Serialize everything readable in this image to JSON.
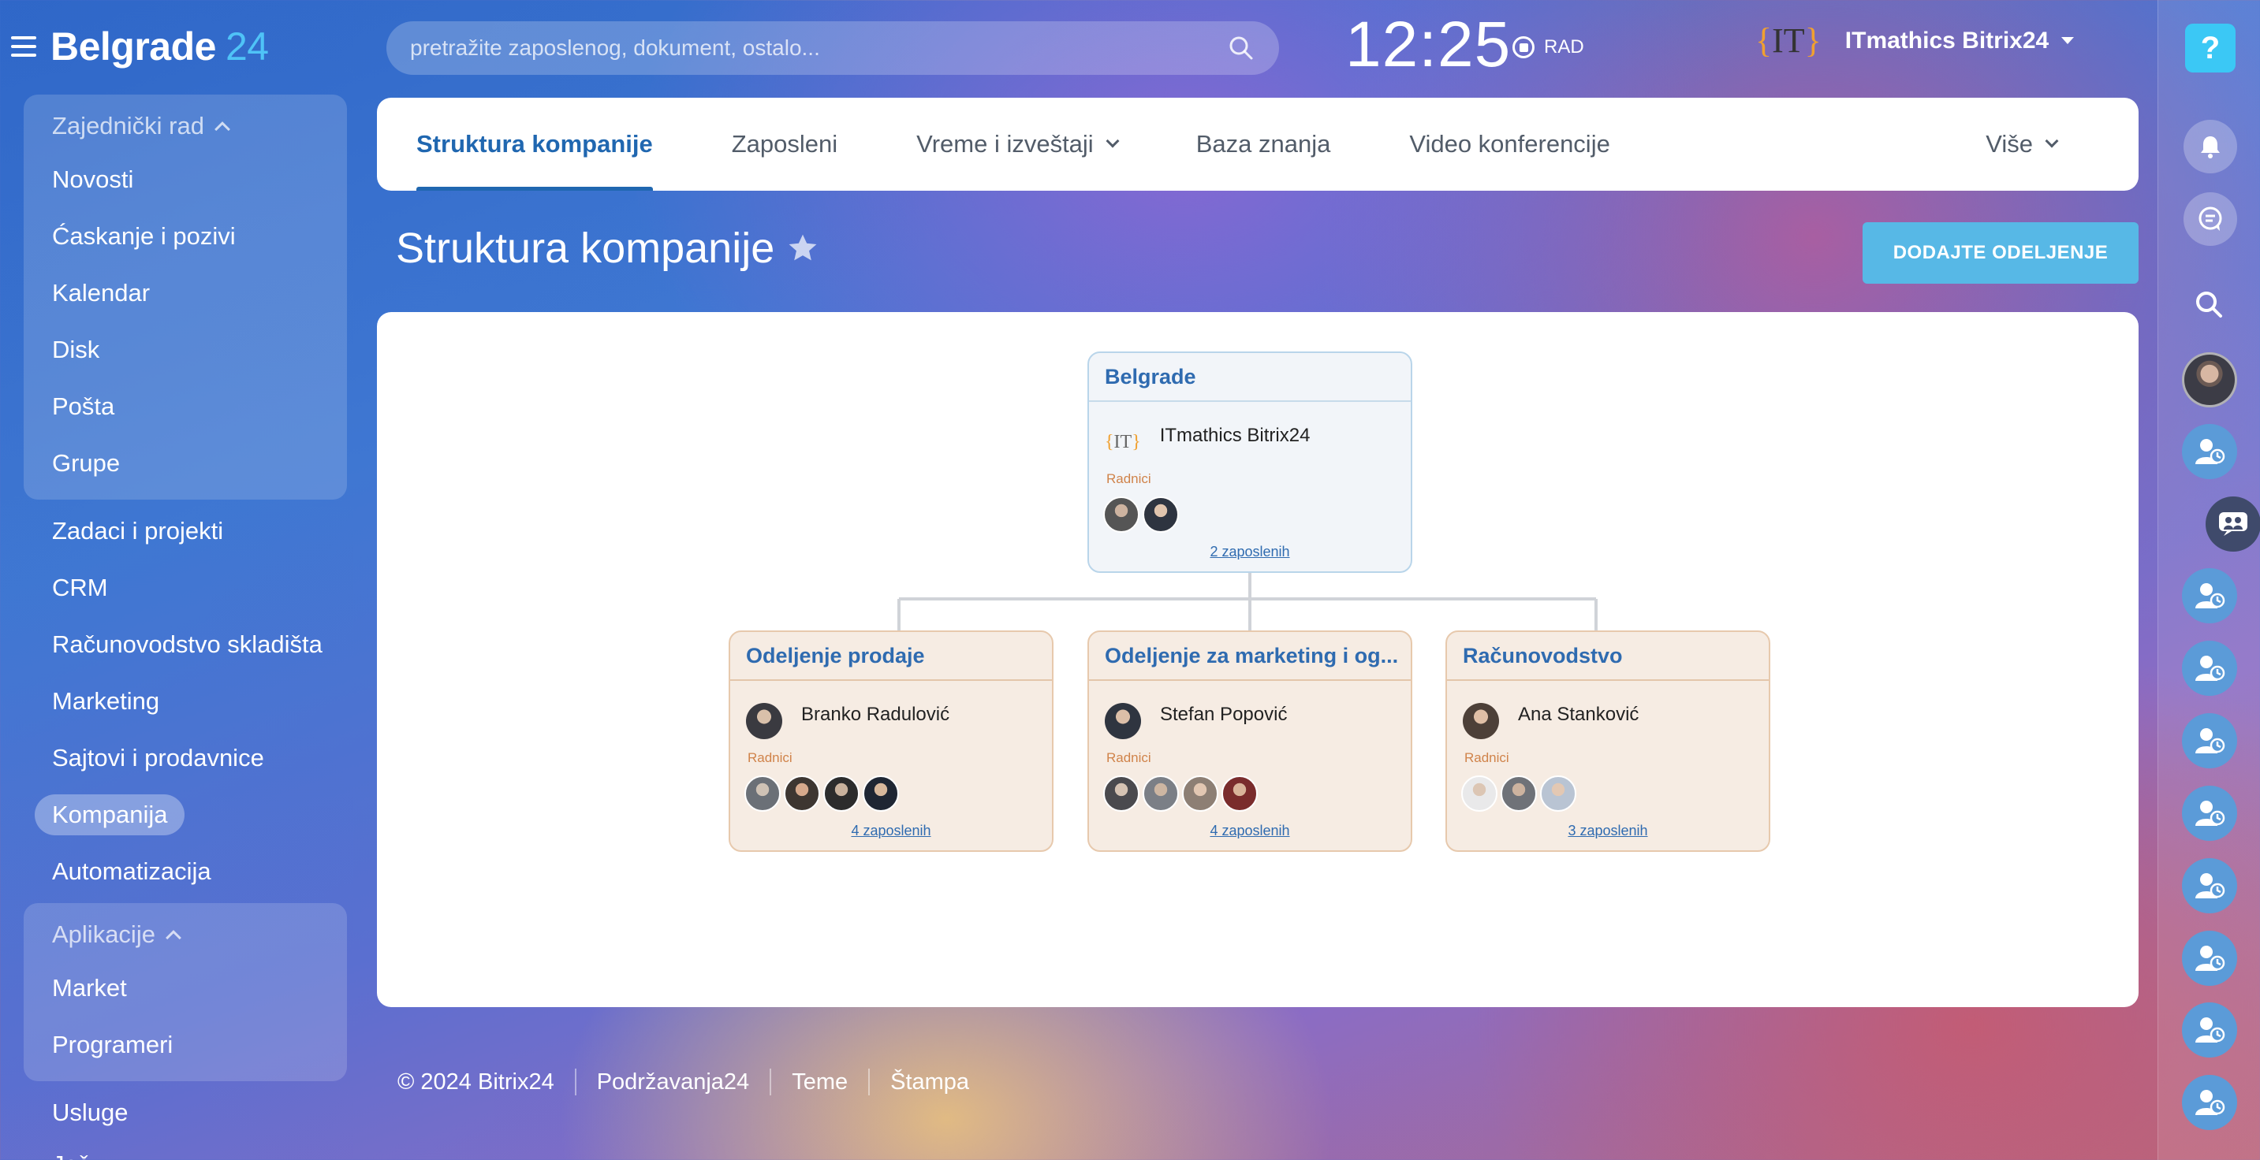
{
  "header": {
    "logo_text": "Belgrade",
    "logo_number": "24",
    "search_placeholder": "pretražite zaposlenog, dokument, ostalo...",
    "clock": "12:25",
    "work_status": "RAD",
    "company_name": "ITmathics Bitrix24",
    "company_logo_text": "IT"
  },
  "sidebar": {
    "group1": {
      "title": "Zajednički rad",
      "items": [
        "Novosti",
        "Ćaskanje i pozivi",
        "Kalendar",
        "Disk",
        "Pošta",
        "Grupe"
      ]
    },
    "items": [
      "Zadaci i projekti",
      "CRM",
      "Računovodstvo skladišta",
      "Marketing",
      "Sajtovi i prodavnice",
      "Kompanija",
      "Automatizacija"
    ],
    "active_item": "Kompanija",
    "group2": {
      "title": "Aplikacije",
      "items": [
        "Market",
        "Programeri"
      ]
    },
    "after_items": [
      "Usluge"
    ],
    "more_label": "Još"
  },
  "tabs": {
    "items": [
      "Struktura kompanije",
      "Zaposleni",
      "Vreme i izveštaji",
      "Baza znanja",
      "Video konferencije"
    ],
    "more": "Više",
    "active": "Struktura kompanije"
  },
  "page": {
    "title": "Struktura kompanije",
    "add_button": "DODAJTE ODELJENJE"
  },
  "org_chart": {
    "root": {
      "title": "Belgrade",
      "head": "ITmathics Bitrix24",
      "head_logo": "IT",
      "workers_label": "Radnici",
      "count": "2 zaposlenih",
      "avatars": 2
    },
    "departments": [
      {
        "title": "Odeljenje prodaje",
        "head": "Branko Radulović",
        "workers_label": "Radnici",
        "count": "4 zaposlenih",
        "avatars": 4
      },
      {
        "title": "Odeljenje za marketing i og...",
        "head": "Stefan Popović",
        "workers_label": "Radnici",
        "count": "4 zaposlenih",
        "avatars": 4
      },
      {
        "title": "Računovodstvo",
        "head": "Ana Stanković",
        "workers_label": "Radnici",
        "count": "3 zaposlenih",
        "avatars": 3
      }
    ]
  },
  "footer": {
    "copyright": "© 2024 Bitrix24",
    "links": [
      "Podržavanja24",
      "Teme",
      "Štampa"
    ]
  },
  "right_rail": {
    "help_label": "?",
    "icons": [
      "bell-icon",
      "chat-icon",
      "search-icon"
    ]
  },
  "colors": {
    "accent": "#2067b0",
    "button": "#57b8e6",
    "help": "#3bc8f5",
    "logo_number": "#4fc3f7"
  }
}
